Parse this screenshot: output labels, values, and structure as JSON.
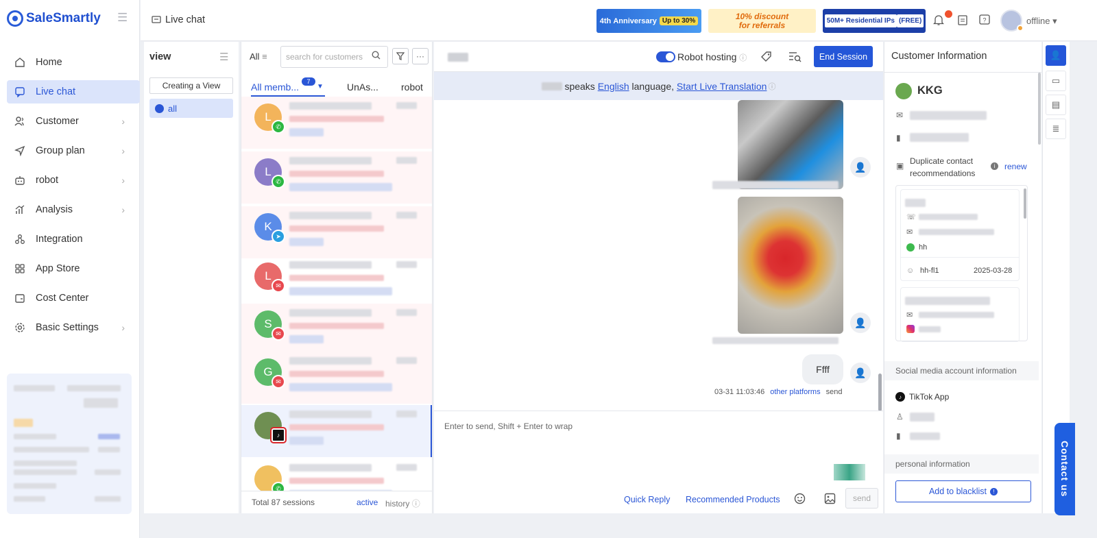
{
  "brand": {
    "name": "SaleSmartly"
  },
  "header": {
    "title": "Live chat",
    "status": "offline",
    "banners": {
      "anniversary": "Anniversary",
      "anniversary_pill": "Up to 30%",
      "anniversary_num": "4th",
      "referral_line1": "10% discount",
      "referral_line2": "for referrals",
      "ips": "50M+ Residential IPs",
      "ips_tag": "(FREE)"
    }
  },
  "nav": [
    {
      "label": "Home",
      "icon": "home-icon"
    },
    {
      "label": "Live chat",
      "icon": "chat-icon",
      "active": true
    },
    {
      "label": "Customer",
      "icon": "users-icon",
      "arrow": true
    },
    {
      "label": "Group plan",
      "icon": "send-icon",
      "arrow": true
    },
    {
      "label": "robot",
      "icon": "robot-icon",
      "arrow": true
    },
    {
      "label": "Analysis",
      "icon": "analysis-icon",
      "arrow": true
    },
    {
      "label": "Integration",
      "icon": "integration-icon"
    },
    {
      "label": "App Store",
      "icon": "apps-icon"
    },
    {
      "label": "Cost Center",
      "icon": "wallet-icon"
    },
    {
      "label": "Basic Settings",
      "icon": "settings-icon",
      "arrow": true
    }
  ],
  "views": {
    "title": "view",
    "create_label": "Creating a View",
    "all_label": "all"
  },
  "sessions": {
    "filter_label": "All",
    "search_placeholder": "search for customers",
    "tabs": {
      "all": "All memb...",
      "badge": "7",
      "unassigned": "UnAs...",
      "robot": "robot"
    },
    "rows": [
      {
        "initial": "L",
        "color": "#f3b45b",
        "channel": "whatsapp",
        "bg": "pink"
      },
      {
        "initial": "L",
        "color": "#8b7cc8",
        "channel": "whatsapp",
        "bg": "pink"
      },
      {
        "initial": "K",
        "color": "#5b8ce8",
        "channel": "telegram",
        "bg": "pink"
      },
      {
        "initial": "L",
        "color": "#e86a6a",
        "channel": "email",
        "bg": "white"
      },
      {
        "initial": "S",
        "color": "#5dbb6a",
        "channel": "email",
        "bg": "pink"
      },
      {
        "initial": "G",
        "color": "#5dbb6a",
        "channel": "email",
        "bg": "pink"
      },
      {
        "initial": "",
        "color": "#6f8f52",
        "channel": "tiktok",
        "bg": "selected"
      },
      {
        "initial": "",
        "color": "#f0c060",
        "channel": "whatsapp",
        "bg": "white"
      }
    ],
    "total": "Total 87 sessions",
    "active": "active",
    "history": "history"
  },
  "chat": {
    "robot_hosting": "Robot hosting",
    "end_session": "End Session",
    "lang_mid": " speaks ",
    "lang": "English",
    "lang_after": " language, ",
    "translate": "Start Live Translation",
    "message": "Ffff",
    "timestamp": "03-31 11:03:46",
    "platform": "other platforms",
    "sent": "send",
    "composer_placeholder": "Enter to send, Shift + Enter to wrap",
    "quick_reply": "Quick Reply",
    "recommended": "Recommended Products",
    "send": "send"
  },
  "customer": {
    "title": "Customer Information",
    "name": "KKG",
    "duplicate": "Duplicate contact recommendations",
    "renew": "renew",
    "dup_card1": {
      "line": "hh",
      "owner": "hh-fl1",
      "date": "2025-03-28"
    },
    "social_header": "Social media account information",
    "social_app": "TikTok App",
    "personal_header": "personal information",
    "blacklist": "Add to blacklist"
  },
  "contact_us": "Contact us"
}
